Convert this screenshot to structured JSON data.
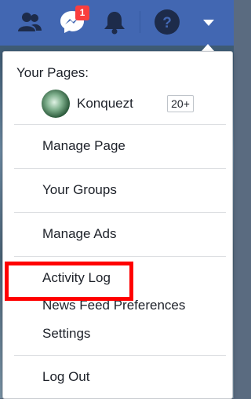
{
  "topbar": {
    "icons": [
      "friends-icon",
      "messenger-icon",
      "notifications-icon",
      "help-icon",
      "account-menu-icon"
    ],
    "messenger_badge": "1",
    "color": "#4267b2"
  },
  "menu": {
    "your_pages_label": "Your Pages:",
    "page": {
      "name": "Konquezt",
      "count": "20+"
    },
    "items": {
      "manage_page": "Manage Page",
      "your_groups": "Your Groups",
      "manage_ads": "Manage Ads",
      "activity_log": "Activity Log",
      "news_feed_prefs": "News Feed Preferences",
      "settings": "Settings",
      "log_out": "Log Out"
    },
    "highlight_color": "#ff0000"
  }
}
